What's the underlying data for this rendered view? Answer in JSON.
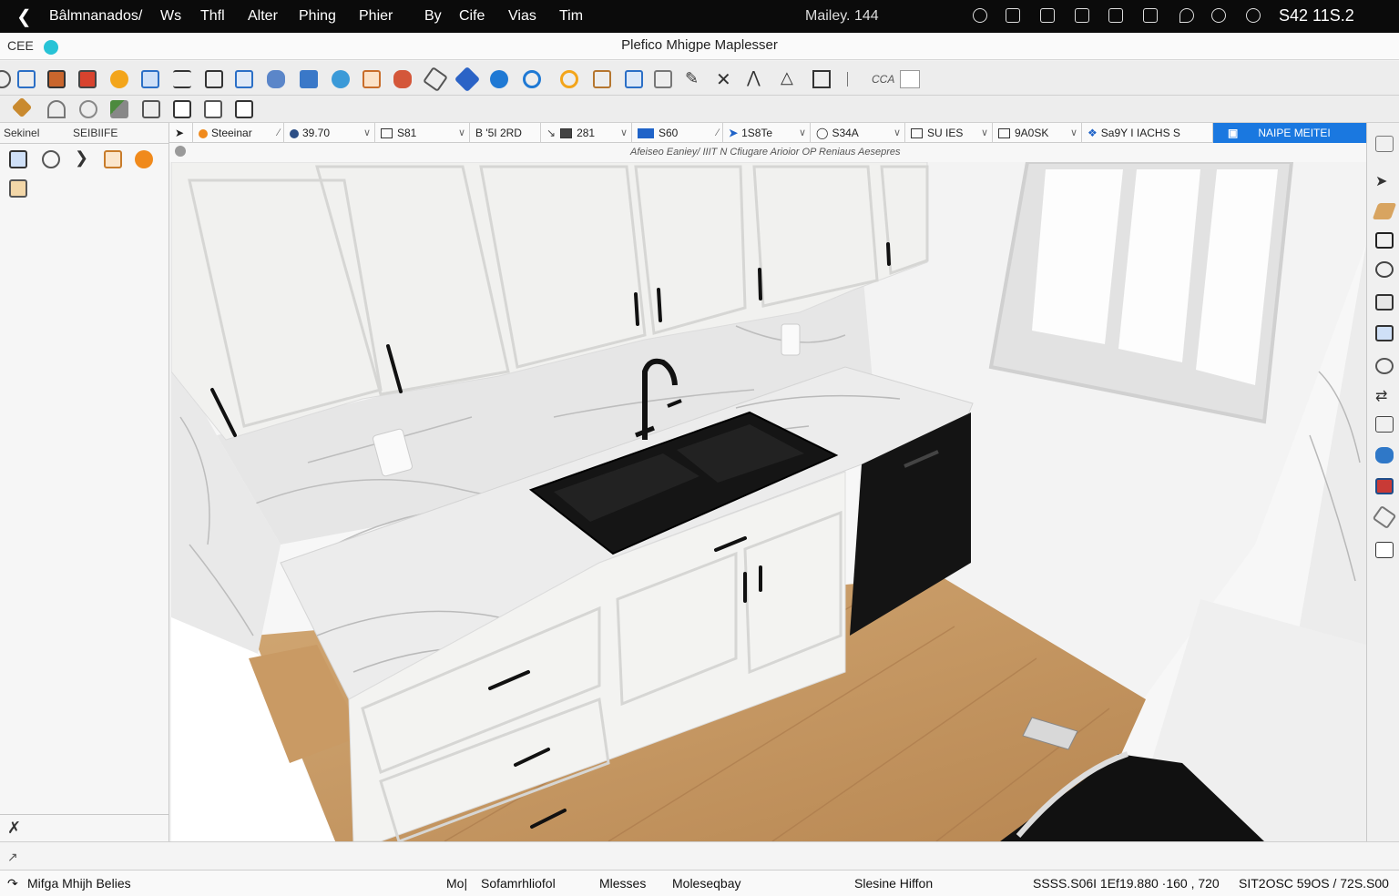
{
  "menubar": {
    "app_name": "Bâlmnanados/",
    "items": [
      "Ws",
      "Thfl",
      "Alter",
      "Phing",
      "Phier",
      "By",
      "Cife",
      "Vias",
      "Tim"
    ],
    "center_text": "Mailey. 144",
    "clock": "S42 11S.2"
  },
  "titlebar": {
    "left_label": "CEE",
    "title": "Plefico Mhigpe Maplesser"
  },
  "toolbar2": {
    "right_label": "CCA"
  },
  "left_panel": {
    "header_left": "Sekinel",
    "header_right": "SEIBIIFE"
  },
  "options": [
    {
      "label": "Steeinar",
      "chevron": true
    },
    {
      "label": "39.70",
      "chevron": true
    },
    {
      "label": "S81",
      "chevron": true
    },
    {
      "label": "B '5I 2RD",
      "chevron": false
    },
    {
      "label": "281",
      "chevron": true
    },
    {
      "label": "S60",
      "chevron": false
    },
    {
      "label": "1S8Te",
      "chevron": true
    },
    {
      "label": "S34A",
      "chevron": true
    },
    {
      "label": "SU IES",
      "chevron": true
    },
    {
      "label": "9A0SK",
      "chevron": true
    },
    {
      "label": "Sa9Y I IACHS S",
      "chevron": false
    },
    {
      "label": "NAIPE MEITEI",
      "chevron": false
    }
  ],
  "hint_text": "Afeiseo Eaniey/ IIIT N Cfiugare Arioior OP Reniaus Aesepres",
  "statusbar": {
    "left": "Mifga Mhijh Belies",
    "mode": "Mo|",
    "snap": "Sofamrhliofol",
    "msg1": "Mlesses",
    "msg2": "Moleseqbay",
    "selection": "Slesine Hiffon",
    "coords": "SSSS.S06I 1Ef19.880 ·160 , 720",
    "scale": "SIT2OSC 59OS / 72S.S00"
  },
  "colors": {
    "accent_blue": "#1a78e0",
    "menubar_bg": "#0b0b0b",
    "cabinet_white": "#f3f3f1",
    "wood_floor": "#c9a070",
    "sink_black": "#151515"
  }
}
